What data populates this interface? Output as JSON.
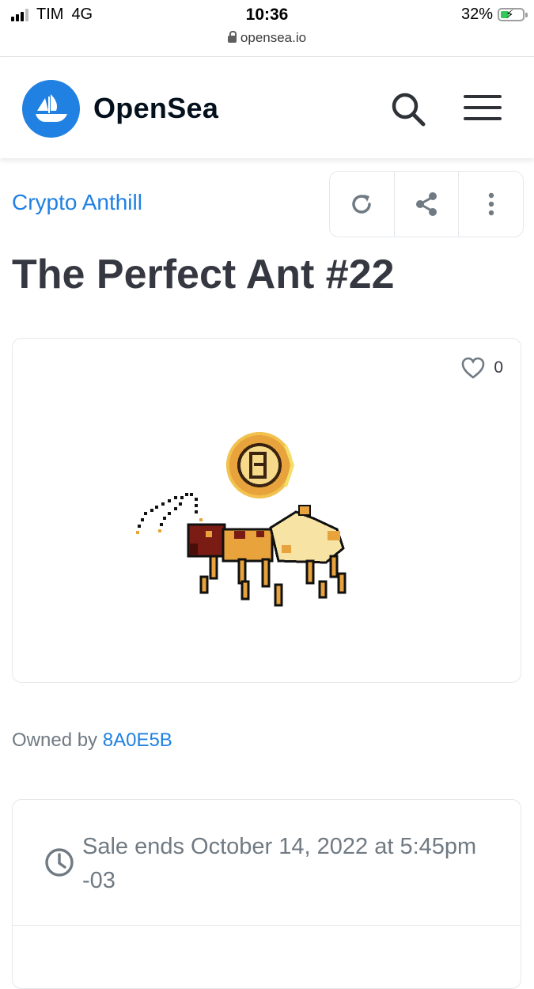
{
  "status_bar": {
    "carrier": "TIM",
    "network": "4G",
    "time": "10:36",
    "battery": "32%",
    "battery_level": 0.32
  },
  "browser": {
    "url": "opensea.io"
  },
  "header": {
    "brand": "OpenSea"
  },
  "asset": {
    "collection": "Crypto Anthill",
    "title": "The Perfect Ant #22",
    "likes": "0",
    "owned_by_label": "Owned by",
    "owner": "8A0E5B"
  },
  "sale": {
    "ends_text": "Sale ends October 14, 2022 at 5:45pm -03"
  },
  "colors": {
    "accent": "#2081e2",
    "title": "#353840",
    "muted": "#707a83",
    "border": "#e5e8eb"
  },
  "icons": [
    "shield-lock-icon",
    "search-icon",
    "menu-icon",
    "refresh-icon",
    "share-icon",
    "more-icon",
    "heart-icon",
    "clock-icon"
  ]
}
